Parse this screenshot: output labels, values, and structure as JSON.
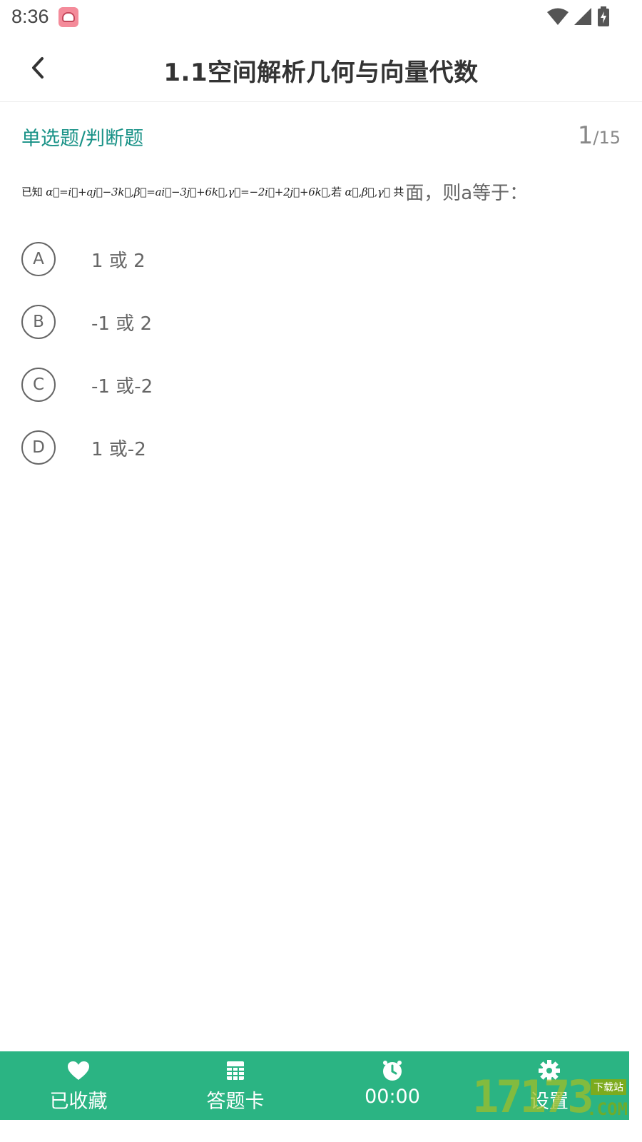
{
  "status_bar": {
    "time": "8:36"
  },
  "header": {
    "title": "1.1空间解析几何与向量代数"
  },
  "question": {
    "type": "单选题/判断题",
    "index": "1",
    "total": "/15",
    "formula_prefix": "已知",
    "formula_body": "α⃗=i⃗+aj⃗−3k⃗,β⃗=ai⃗−3j⃗+6k⃗,γ⃗=−2i⃗+2j⃗+6k⃗,",
    "formula_ruo": "若",
    "formula_vectors": "α⃗,β⃗,γ⃗",
    "formula_gong": "共",
    "text": "面，则a等于："
  },
  "options": [
    {
      "letter": "A",
      "text": "1 或 2"
    },
    {
      "letter": "B",
      "text": "-1 或 2"
    },
    {
      "letter": "C",
      "text": "-1 或-2"
    },
    {
      "letter": "D",
      "text": "1 或-2"
    }
  ],
  "bottom_bar": {
    "favorite_label": "已收藏",
    "answer_card_label": "答题卡",
    "timer": "00:00",
    "settings_label": "设置"
  },
  "watermark": {
    "digits": "17173",
    "tag": "下载站",
    "suffix": ".COM"
  },
  "colors": {
    "accent_teal": "#199287",
    "bottom_bar_green": "#2bb483"
  },
  "icons": {
    "back": "chevron-left-icon",
    "favorite": "heart-icon",
    "answer_card": "grid-icon",
    "timer": "clock-icon",
    "settings": "gear-icon"
  }
}
